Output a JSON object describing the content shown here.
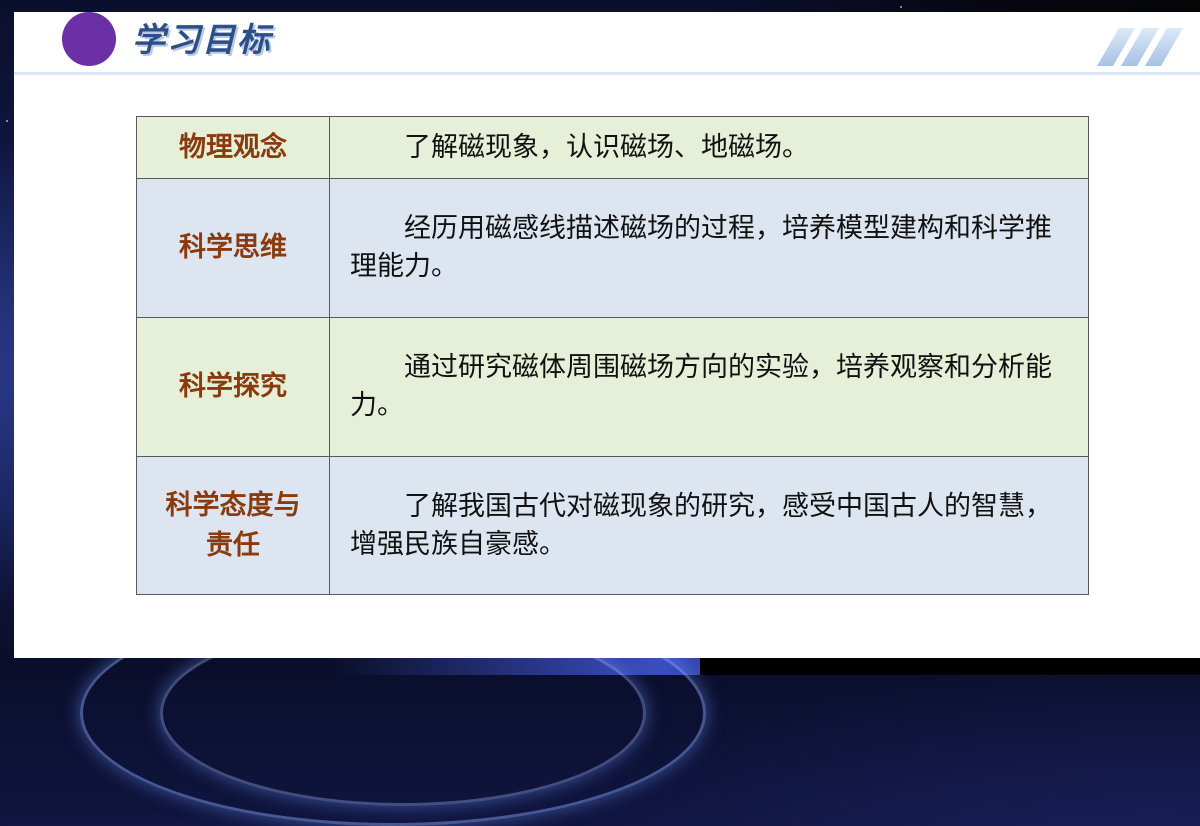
{
  "slide": {
    "title": "学习目标"
  },
  "objectives": [
    {
      "category": "物理观念",
      "description": "了解磁现象，认识磁场、地磁场。"
    },
    {
      "category": "科学思维",
      "description": "经历用磁感线描述磁场的过程，培养模型建构和科学推理能力。"
    },
    {
      "category": "科学探究",
      "description": "通过研究磁体周围磁场方向的实验，培养观察和分析能力。"
    },
    {
      "category": "科学态度与责任",
      "description": "了解我国古代对磁现象的研究，感受中国古人的智慧，增强民族自豪感。"
    }
  ],
  "colors": {
    "accent_circle": "#6b2fa6",
    "title_text": "#2c4f86",
    "category_text": "#8b3a0e",
    "row_green": "#e6f0d8",
    "row_blue": "#dde6f0"
  }
}
